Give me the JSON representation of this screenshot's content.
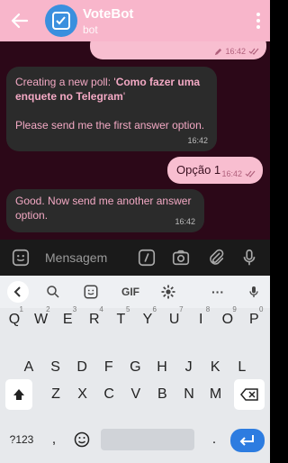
{
  "header": {
    "title": "VoteBot",
    "subtitle": "bot"
  },
  "messages": {
    "prev_time": "16:42",
    "bot_poll": {
      "prefix": "Creating a new poll: '",
      "poll_title": "Como fazer uma enquete no Telegram",
      "suffix": "'",
      "instruction": "Please send me the first answer option.",
      "time": "16:42"
    },
    "user_reply": {
      "text": "Opção 1",
      "time": "16:42"
    },
    "bot_next": {
      "text": "Good. Now send me another answer option.",
      "time": "16:42"
    }
  },
  "input": {
    "placeholder": "Mensagem"
  },
  "keyboard": {
    "toolbar": {
      "gif_label": "GIF"
    },
    "row1": [
      "Q",
      "W",
      "E",
      "R",
      "T",
      "Y",
      "U",
      "I",
      "O",
      "P"
    ],
    "row1_hints": [
      "1",
      "2",
      "3",
      "4",
      "5",
      "6",
      "7",
      "8",
      "9",
      "0"
    ],
    "row2": [
      "A",
      "S",
      "D",
      "F",
      "G",
      "H",
      "J",
      "K",
      "L"
    ],
    "row3": [
      "Z",
      "X",
      "C",
      "V",
      "B",
      "N",
      "M"
    ],
    "symbols_label": "?123",
    "comma": ",",
    "period": "."
  },
  "colors": {
    "header": "#f8b6cb",
    "chat_bg": "#2c0818",
    "accent": "#2d7ce0"
  }
}
